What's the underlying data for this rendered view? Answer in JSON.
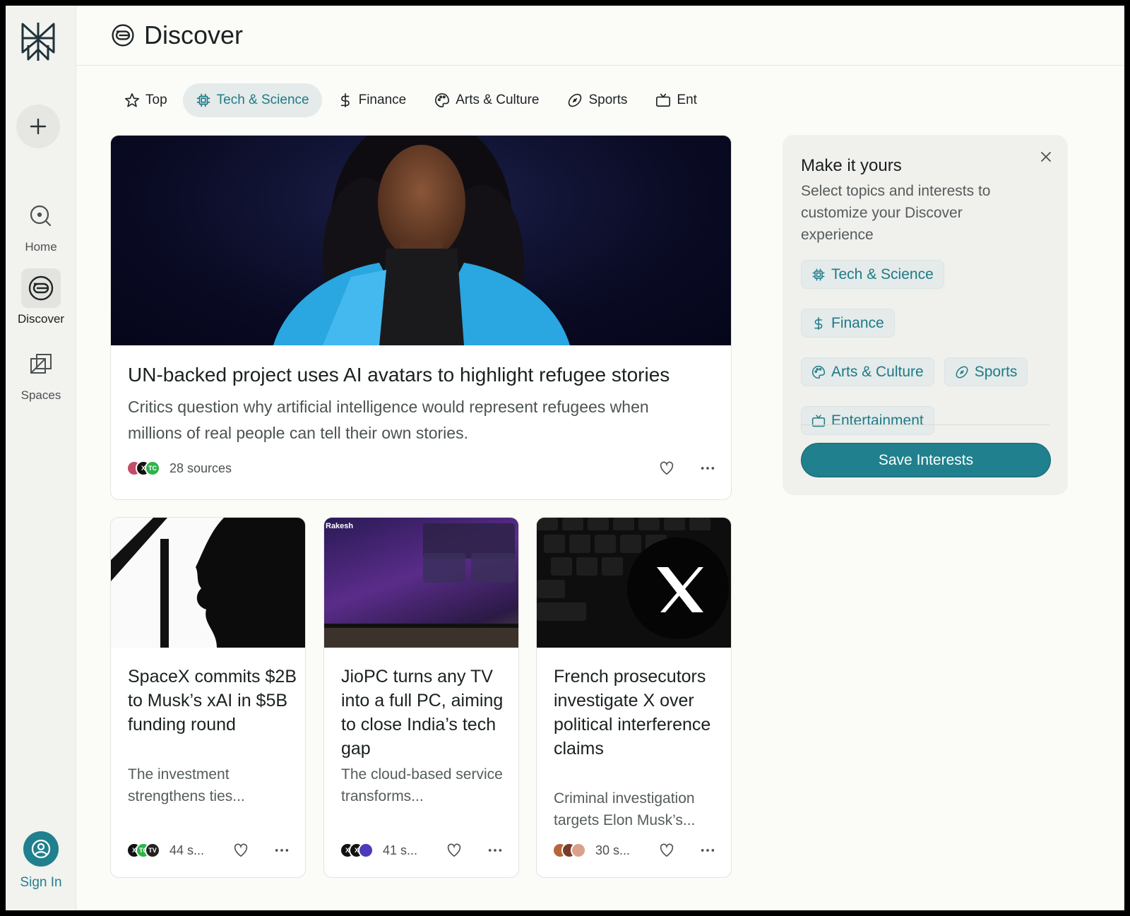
{
  "sidebar": {
    "items": [
      {
        "label": "Home",
        "icon": "search-icon"
      },
      {
        "label": "Discover",
        "icon": "discover-icon"
      },
      {
        "label": "Spaces",
        "icon": "spaces-icon"
      }
    ],
    "sign_in": "Sign In"
  },
  "header": {
    "title": "Discover"
  },
  "tabs": [
    {
      "label": "Top",
      "icon": "star-icon"
    },
    {
      "label": "Tech & Science",
      "icon": "chip-icon",
      "active": true
    },
    {
      "label": "Finance",
      "icon": "dollar-icon"
    },
    {
      "label": "Arts & Culture",
      "icon": "palette-icon"
    },
    {
      "label": "Sports",
      "icon": "football-icon"
    },
    {
      "label": "Ent",
      "icon": "tv-icon"
    }
  ],
  "hero": {
    "title": "UN-backed project uses AI avatars to highlight refugee stories",
    "description": "Critics question why artificial intelligence would represent refugees when millions of real people can tell their own stories.",
    "sources": "28 sources"
  },
  "cards": [
    {
      "title": "SpaceX commits $2B to Musk’s xAI in $5B funding round",
      "description": "The investment strengthens ties...",
      "sources": "44 s..."
    },
    {
      "title": "JioPC turns any TV into a full PC, aiming to close India’s tech gap",
      "description": "The cloud-based service transforms...",
      "sources": "41 s...",
      "image_text": "Rakesh"
    },
    {
      "title": "French prosecutors investigate X over political interference claims",
      "description": "Criminal investigation targets Elon Musk’s...",
      "sources": "30 s..."
    }
  ],
  "panel": {
    "title": "Make it yours",
    "subtitle": "Select topics and interests to customize your Discover experience",
    "chips": [
      {
        "label": "Tech & Science",
        "icon": "chip-icon"
      },
      {
        "label": "Finance",
        "icon": "dollar-icon"
      },
      {
        "label": "Arts & Culture",
        "icon": "palette-icon"
      },
      {
        "label": "Sports",
        "icon": "football-icon"
      },
      {
        "label": "Entertainment",
        "icon": "tv-icon"
      }
    ],
    "save_label": "Save Interests"
  },
  "colors": {
    "accent": "#20808d",
    "accent_bg": "#e4ebea",
    "background": "#fbfbf8"
  }
}
